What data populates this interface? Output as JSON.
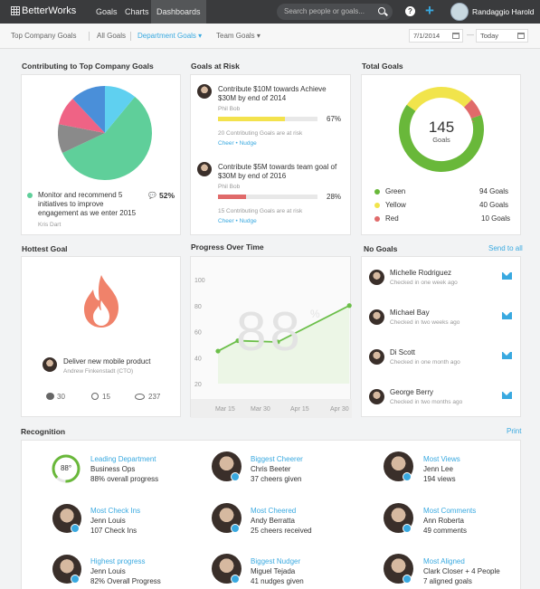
{
  "topbar": {
    "logo": "BetterWorks",
    "nav": [
      "Goals",
      "Charts",
      "Dashboards"
    ],
    "search_placeholder": "Search people or goals...",
    "help": "?",
    "add": "+",
    "user": "Randaggio Harold"
  },
  "subbar": {
    "items": [
      "Top Company Goals",
      "All Goals",
      "Department Goals",
      "Team Goals"
    ],
    "date_from": "7/1/2014",
    "date_to": "Today"
  },
  "contributing": {
    "title": "Contributing to Top Company Goals",
    "slices": [
      {
        "label": "green",
        "value": 57,
        "color": "#5fcf9a"
      },
      {
        "label": "gray",
        "value": 10,
        "color": "#8a8a8a"
      },
      {
        "label": "pink",
        "value": 10,
        "color": "#ef6385"
      },
      {
        "label": "blue",
        "value": 12,
        "color": "#4a8fd9"
      },
      {
        "label": "cyan",
        "value": 11,
        "color": "#5fd0f0"
      }
    ],
    "goal_text": "Monitor and recommend 5 initiatives to improve engagement as we enter 2015",
    "goal_owner": "Kris Dart",
    "goal_pct": "52%"
  },
  "risk": {
    "title": "Goals at Risk",
    "items": [
      {
        "text": "Contribute $10M towards Achieve $30M by end of 2014",
        "owner": "Phil Bob",
        "pct": "67%",
        "progress": 0.67,
        "color": "#f3e24d",
        "note": "20 Contributing Goals are at risk",
        "actions": "Cheer • Nudge"
      },
      {
        "text": "Contribute $5M towards team goal of $30M by end of 2016",
        "owner": "Phil Bob",
        "pct": "28%",
        "progress": 0.28,
        "color": "#e06a6a",
        "note": "15 Contributing Goals are at risk",
        "actions": "Cheer • Nudge"
      }
    ]
  },
  "total": {
    "title": "Total Goals",
    "count": "145",
    "count_label": "Goals",
    "legend": [
      {
        "label": "Green",
        "value": "94 Goals",
        "n": 94,
        "color": "#69b83a"
      },
      {
        "label": "Yellow",
        "value": "40 Goals",
        "n": 40,
        "color": "#f1e44b"
      },
      {
        "label": "Red",
        "value": "10 Goals",
        "n": 10,
        "color": "#e06a6a"
      }
    ]
  },
  "hottest": {
    "title": "Hottest Goal",
    "goal": "Deliver new mobile product",
    "owner": "Andrew Finkenstadt (CTO)",
    "comments": "30",
    "cheers": "15",
    "views": "237"
  },
  "progress": {
    "title": "Progress Over Time",
    "big_value": "88",
    "big_unit": "%",
    "chart_data": {
      "type": "line",
      "x": [
        "Mar 15",
        "Mar 30",
        "Apr 15",
        "Apr 30"
      ],
      "y_ticks": [
        "100",
        "80",
        "60",
        "40",
        "20"
      ],
      "points": [
        {
          "x": 0,
          "y": 45
        },
        {
          "x": 0.5,
          "y": 53
        },
        {
          "x": 1.5,
          "y": 52
        },
        {
          "x": 3.3,
          "y": 80
        }
      ],
      "ylim": [
        20,
        100
      ]
    }
  },
  "nogoals": {
    "title": "No Goals",
    "send_all": "Send to all",
    "people": [
      {
        "name": "Michelle Rodriguez",
        "status": "Checked in one week ago"
      },
      {
        "name": "Michael Bay",
        "status": "Checked in two weeks ago"
      },
      {
        "name": "Di Scott",
        "status": "Checked in one month ago"
      },
      {
        "name": "George Berry",
        "status": "Checked in two months ago"
      }
    ]
  },
  "recognition": {
    "title": "Recognition",
    "print": "Print",
    "items": [
      {
        "title": "Leading Department",
        "l1": "Business Ops",
        "l2": "88% overall progress",
        "gauge": "88°"
      },
      {
        "title": "Biggest Cheerer",
        "l1": "Chris Beeter",
        "l2": "37 cheers given"
      },
      {
        "title": "Most Views",
        "l1": "Jenn Lee",
        "l2": "194 views"
      },
      {
        "title": "Most Check Ins",
        "l1": "Jenn Louis",
        "l2": "107 Check Ins"
      },
      {
        "title": "Most Cheered",
        "l1": "Andy Berratta",
        "l2": "25 cheers received"
      },
      {
        "title": "Most Comments",
        "l1": "Ann Roberta",
        "l2": "49 comments"
      },
      {
        "title": "Highest progress",
        "l1": "Jenn Louis",
        "l2": "82% Overall Progress"
      },
      {
        "title": "Biggest Nudger",
        "l1": "Miguel Tejada",
        "l2": "41 nudges given"
      },
      {
        "title": "Most Aligned",
        "l1": "Clark Closer + 4 People",
        "l2": "7 aligned goals"
      }
    ]
  }
}
